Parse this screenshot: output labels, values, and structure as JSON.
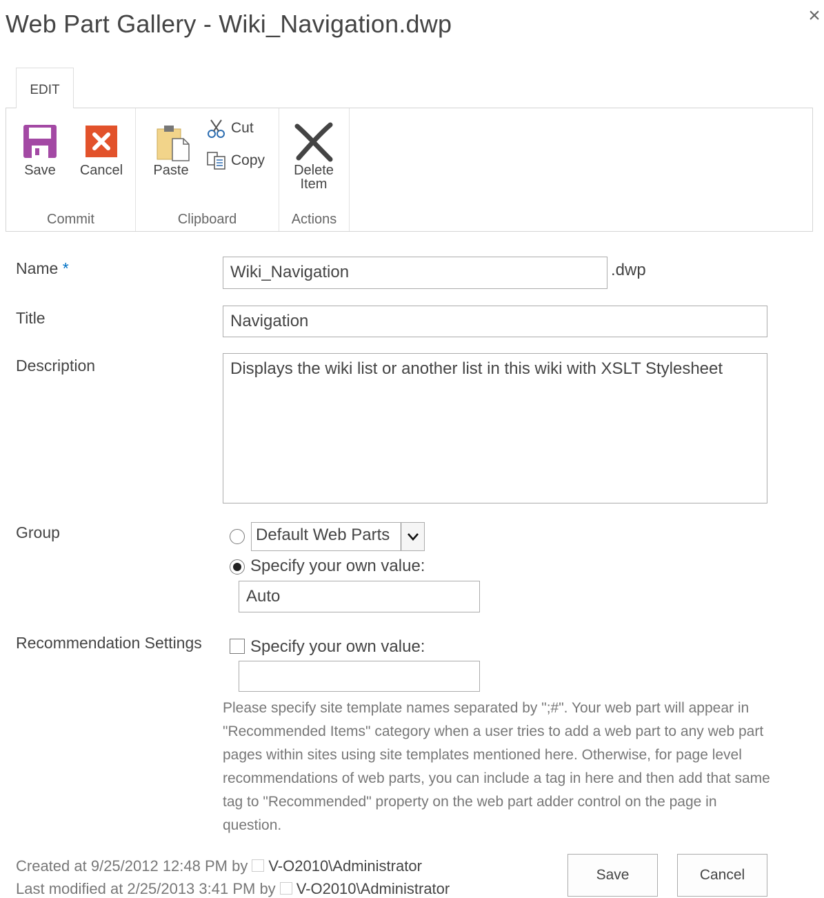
{
  "dialog": {
    "title": "Web Part Gallery - Wiki_Navigation.dwp",
    "close_glyph": "×"
  },
  "ribbon": {
    "tab": "EDIT",
    "groups": {
      "commit": {
        "label": "Commit",
        "save": "Save",
        "cancel": "Cancel"
      },
      "clipboard": {
        "label": "Clipboard",
        "paste": "Paste",
        "cut": "Cut",
        "copy": "Copy"
      },
      "actions": {
        "label": "Actions",
        "delete_line1": "Delete",
        "delete_line2": "Item"
      }
    },
    "icons": {
      "save": "floppy-disk-icon",
      "cancel": "cancel-x-icon",
      "paste": "paste-clipboard-icon",
      "cut": "scissors-icon",
      "copy": "copy-icon",
      "delete": "delete-x-icon"
    },
    "colors": {
      "save": "#a349a4",
      "cancel": "#e2522b"
    }
  },
  "form": {
    "name": {
      "label": "Name",
      "required_marker": "*",
      "value": "Wiki_Navigation",
      "suffix": ".dwp"
    },
    "title": {
      "label": "Title",
      "value": "Navigation"
    },
    "description": {
      "label": "Description",
      "value": "Displays the wiki list or another list in this wiki with XSLT Stylesheet"
    },
    "group": {
      "label": "Group",
      "dropdown_value": "Default Web Parts",
      "dropdown_selected": false,
      "own_value_label": "Specify your own value:",
      "own_value_selected": true,
      "own_value": "Auto"
    },
    "recommendation": {
      "label": "Recommendation Settings",
      "checkbox_label": "Specify your own value:",
      "checked": false,
      "value": "",
      "help": "Please specify site template names separated by \";#\". Your web part will appear in \"Recommended Items\" category when a user tries to add a web part to any web part pages within sites using site templates mentioned here. Otherwise, for page level recommendations of web parts, you can include a tag in here and then add that same tag to \"Recommended\" property on the web part adder control on the page in question."
    }
  },
  "footer": {
    "created_prefix": "Created at 9/25/2012 12:48 PM  by",
    "created_user": "V-O2010\\Administrator",
    "modified_prefix": "Last modified at 2/25/2013 3:41 PM  by",
    "modified_user": "V-O2010\\Administrator",
    "save": "Save",
    "cancel": "Cancel"
  }
}
